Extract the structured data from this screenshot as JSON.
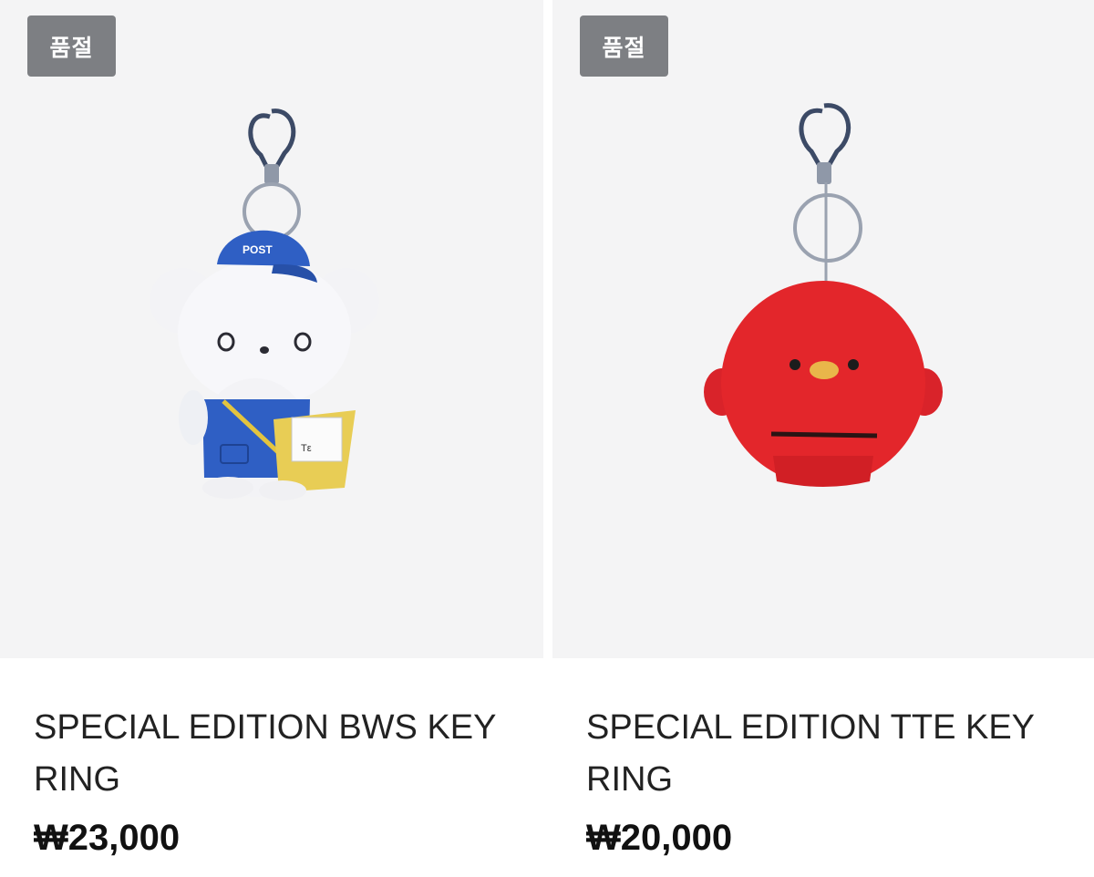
{
  "products": [
    {
      "badge": "품절",
      "name": "SPECIAL EDITION BWS KEYRING",
      "price": "₩23,000",
      "hat_text": "POST",
      "image_icon": "bear-mail-carrier-keyring"
    },
    {
      "badge": "품절",
      "name": "SPECIAL EDITION TTE KEY RING",
      "price": "₩20,000",
      "image_icon": "red-bird-keyring"
    }
  ],
  "colors": {
    "thumb_bg": "#f4f4f5",
    "badge_bg": "#7d7f83",
    "bear_hat": "#2f5fc4",
    "bird_red": "#e3262b"
  }
}
